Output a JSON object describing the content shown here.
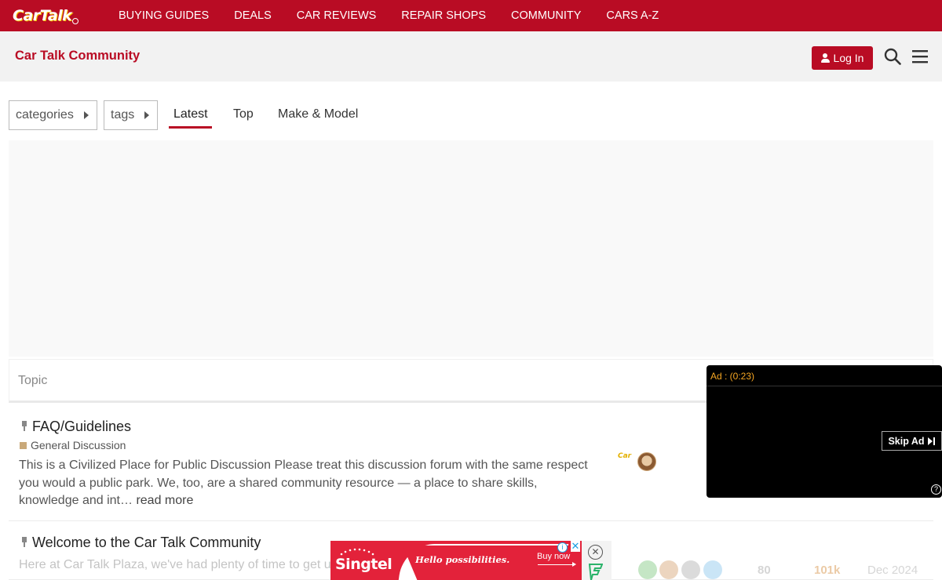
{
  "brand": {
    "logo": "CarTalk",
    "accent": "#b90c24"
  },
  "topnav": [
    "BUYING GUIDES",
    "DEALS",
    "CAR REVIEWS",
    "REPAIR SHOPS",
    "COMMUNITY",
    "CARS A-Z"
  ],
  "header": {
    "title": "Car Talk Community",
    "login_label": "Log In"
  },
  "filters": {
    "categories": "categories",
    "tags": "tags"
  },
  "tabs": [
    {
      "label": "Latest",
      "active": true
    },
    {
      "label": "Top",
      "active": false
    },
    {
      "label": "Make & Model",
      "active": false
    }
  ],
  "topic_list": {
    "header": "Topic",
    "topics": [
      {
        "title": "FAQ/Guidelines",
        "category": "General Discussion",
        "excerpt": "This is a Civilized Place for Public Discussion Please treat this discussion forum with the same respect you would a public park. We, too, are a shared community resource — a place to share skills, knowledge and int…",
        "read_more": "read more",
        "poster_logo": "Car"
      },
      {
        "title": "Welcome to the Car Talk Community",
        "excerpt": "Here at Car Talk Plaza, we've had plenty of time to get u",
        "replies": "80",
        "views": "101k",
        "activity": "Dec 2024"
      }
    ]
  },
  "video_ad": {
    "timer": "Ad : (0:23)",
    "skip_label": "Skip Ad",
    "help": "?"
  },
  "banner_ad": {
    "brand": "Singtel",
    "slogan": "Hello possibilities.",
    "cta": "Buy now",
    "adchoices": "i",
    "close": "✕"
  }
}
